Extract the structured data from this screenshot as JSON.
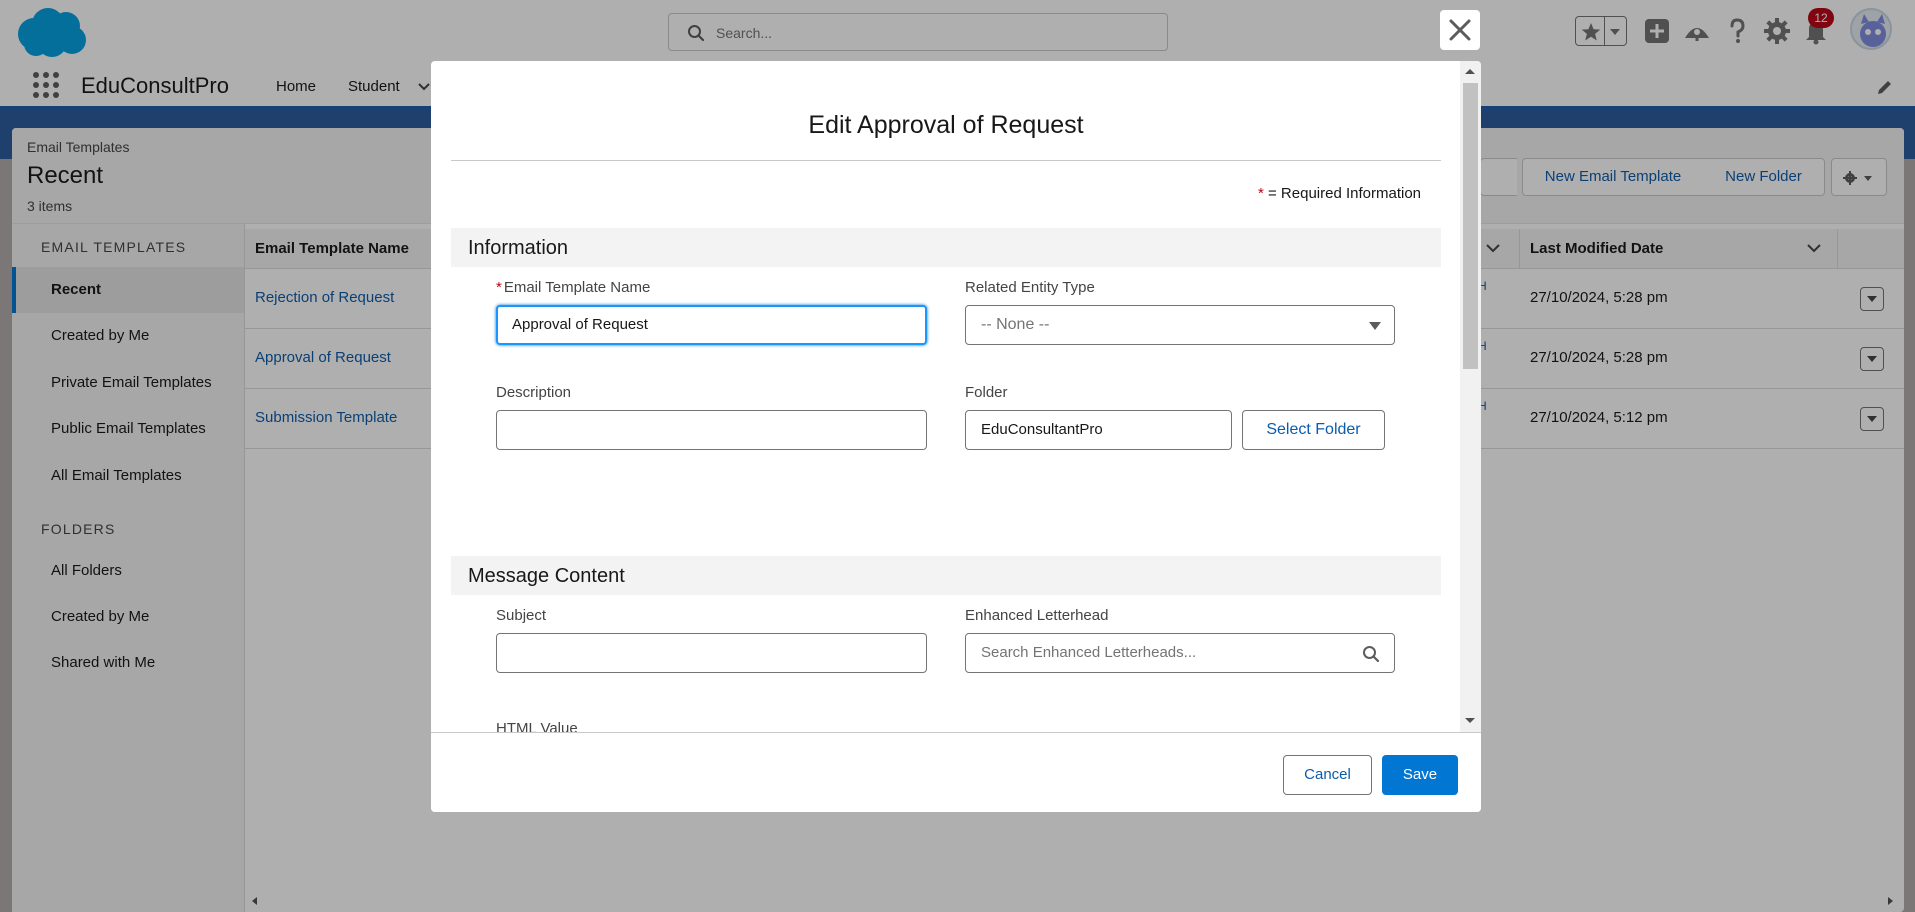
{
  "header": {
    "search_placeholder": "Search...",
    "notification_count": "12"
  },
  "app_nav": {
    "app_name": "EduConsultPro",
    "items": [
      {
        "label": "Home"
      },
      {
        "label": "Student"
      }
    ]
  },
  "page": {
    "breadcrumb": "Email Templates",
    "title": "Recent",
    "item_count": "3 items",
    "buttons": {
      "new_email_template": "New Email Template",
      "new_folder": "New Folder"
    }
  },
  "sidebar": {
    "email_templates_heading": "EMAIL TEMPLATES",
    "email_items": [
      {
        "label": "Recent"
      },
      {
        "label": "Created by Me"
      },
      {
        "label": "Private Email Templates"
      },
      {
        "label": "Public Email Templates"
      },
      {
        "label": "All Email Templates"
      }
    ],
    "folders_heading": "FOLDERS",
    "folder_items": [
      {
        "label": "All Folders"
      },
      {
        "label": "Created by Me"
      },
      {
        "label": "Shared with Me"
      }
    ]
  },
  "table": {
    "columns": [
      "Email Template Name",
      "Last Modified Date"
    ],
    "rows": [
      {
        "name": "Rejection of Request",
        "fragment": "H",
        "modified": "27/10/2024, 5:28 pm"
      },
      {
        "name": "Approval of Request",
        "fragment": "H",
        "modified": "27/10/2024, 5:28 pm"
      },
      {
        "name": "Submission Template",
        "fragment": "H",
        "modified": "27/10/2024, 5:12 pm"
      }
    ]
  },
  "modal": {
    "title": "Edit Approval of Request",
    "required_note_star": "*",
    "required_note": " = Required Information",
    "sections": {
      "information": "Information",
      "message_content": "Message Content"
    },
    "fields": {
      "email_template_name": {
        "label": "Email Template Name",
        "value": "Approval of Request"
      },
      "related_entity_type": {
        "label": "Related Entity Type",
        "value": "-- None --"
      },
      "description": {
        "label": "Description",
        "value": ""
      },
      "folder": {
        "label": "Folder",
        "value": "EduConsultantPro",
        "button": "Select Folder"
      },
      "subject": {
        "label": "Subject",
        "value": ""
      },
      "enhanced_letterhead": {
        "label": "Enhanced Letterhead",
        "placeholder": "Search Enhanced Letterheads..."
      },
      "html_value": {
        "label": "HTML Value"
      }
    },
    "footer": {
      "cancel": "Cancel",
      "save": "Save"
    }
  },
  "colors": {
    "brand_blue": "#0176d3",
    "link_blue": "#0b5cab",
    "required_red": "#ba0517",
    "nav_band": "#1b5eaf"
  }
}
